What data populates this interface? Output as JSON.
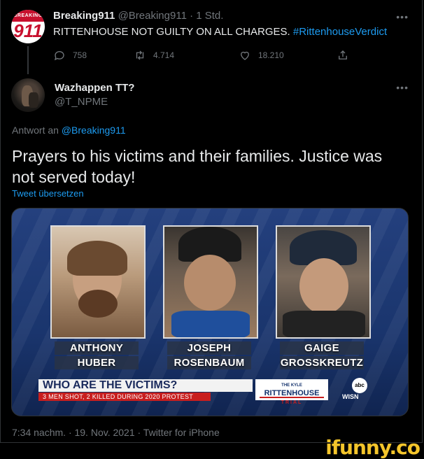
{
  "parent_tweet": {
    "avatar_top_text": "BREAKING",
    "avatar_number": "911",
    "display_name": "Breaking911",
    "meta": "@Breaking911 · 1 Std.",
    "text_main": "RITTENHOUSE NOT GUILTY ON ALL CHARGES.",
    "hashtag": "#RittenhouseVerdict",
    "more_icon": "more-dots-icon",
    "replies": "758",
    "retweets": "4.714",
    "likes": "18.210"
  },
  "tweet": {
    "display_name": "Wazhappen TT?",
    "handle": "@T_NPME",
    "reply_prefix": "Antwort an",
    "reply_to": "@Breaking911",
    "text": "Prayers to his victims and their families. Justice was not served today!",
    "translate_label": "Tweet übersetzen",
    "timestamp": "7:34 nachm. · 19. Nov. 2021 · Twitter for iPhone"
  },
  "media": {
    "persons": [
      {
        "first": "ANTHONY",
        "last": "HUBER"
      },
      {
        "first": "JOSEPH",
        "last": "ROSENBAUM"
      },
      {
        "first": "GAIGE",
        "last": "GROSSKREUTZ"
      }
    ],
    "ticker_headline": "WHO ARE THE VICTIMS?",
    "ticker_sub": "3 MEN SHOT, 2 KILLED DURING 2020 PROTEST",
    "logo_top": "THE KYLE",
    "logo_main": "RITTENHOUSE",
    "logo_bottom": "TRIAL",
    "station_small": "abc",
    "station": "WISN"
  },
  "watermark": "ifunny.co",
  "colors": {
    "accent": "#1d9bf0",
    "muted": "#71767b",
    "background": "#000000"
  }
}
